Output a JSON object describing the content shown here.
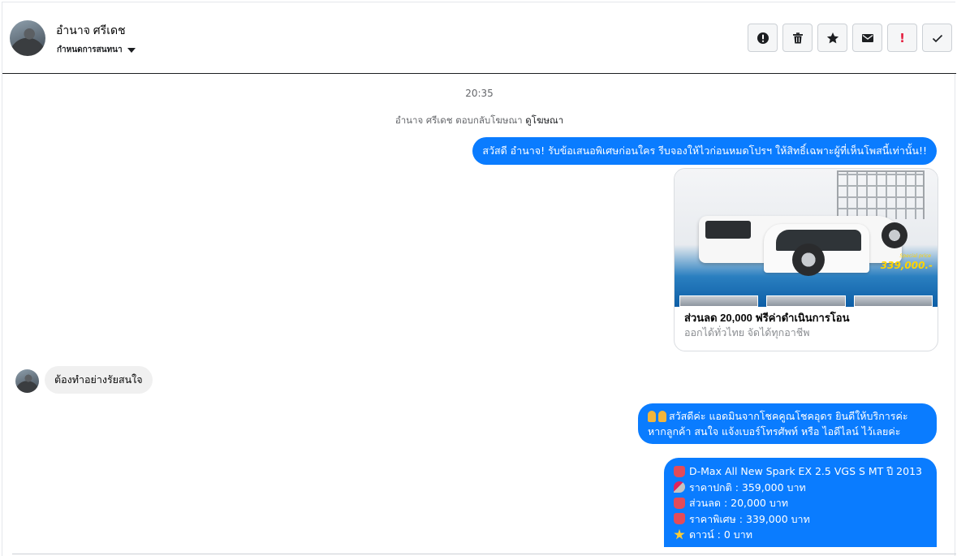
{
  "header": {
    "contact_name": "อำนาจ ศรีเดช",
    "assign_label": "กำหนดการสนทนา",
    "actions": [
      {
        "name": "report-spam",
        "icon": "alert-circle-icon"
      },
      {
        "name": "delete",
        "icon": "trash-icon"
      },
      {
        "name": "star",
        "icon": "star-icon"
      },
      {
        "name": "mark-unread",
        "icon": "envelope-icon"
      },
      {
        "name": "mark-important",
        "icon": "exclamation-icon",
        "label": "!"
      },
      {
        "name": "mark-done",
        "icon": "check-icon"
      }
    ]
  },
  "thread": {
    "time": "20:35",
    "reply_note": "อำนาจ ศรีเดช ตอบกลับโฆษณา",
    "reply_link": "ดูโฆษณา",
    "msg_greeting": "สวัสดี อำนาจ! รับข้อเสนอพิเศษก่อนใคร รีบจองให้ไวก่อนหมดโปรฯ ให้สิทธิ์เฉพาะผู้ที่เห็นโพสนี้เท่านั้น!!",
    "ad_card": {
      "price_badge": "339,000.-",
      "special_label": "Special price",
      "title": "ส่วนลด 20,000 ฟรีค่าดำเนินการโอน",
      "subtitle": "ออกได้ทั่วไทย จัดได้ทุกอาชีพ"
    },
    "msg_customer": "ต้องทำอย่างรัยสนใจ",
    "msg_admin_line1": "สวัสดีค่ะ แอดมินจากโชคคูณโชคอุดร ยินดีให้บริการค่ะ",
    "msg_admin_line2": "หากลูกค้า สนใจ แจ้งเบอร์โทรศัพท์ หรือ ไอดีไลน์  ไว้เลยค่ะ",
    "msg_details": [
      {
        "icon": "car-icon",
        "text": "D-Max All New Spark EX 2.5 VGS S MT ปี 2013"
      },
      {
        "icon": "pushpin-icon",
        "text": "ราคาปกติ : 359,000 บาท"
      },
      {
        "icon": "car-icon",
        "text": "ส่วนลด : 20,000 บาท"
      },
      {
        "icon": "car-icon",
        "text": "ราคาพิเศษ : 339,000 บาท"
      },
      {
        "icon": "star-icon",
        "text": "ดาวน์ : 0 บาท"
      }
    ]
  },
  "colors": {
    "outgoing_bubble": "#0a7cff",
    "incoming_bubble": "#f0f0f0",
    "important_icon": "#e41e3f"
  }
}
